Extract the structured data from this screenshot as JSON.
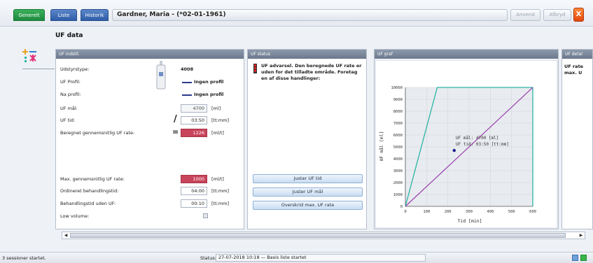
{
  "tabs": {
    "generelt": "Generelt",
    "liste": "Liste",
    "historik": "Historik"
  },
  "patient_title": "Gardner, Maria - (*02-01-1961)",
  "top_buttons": {
    "anvend": "Anvend",
    "afbryd": "Afbryd",
    "close": "X"
  },
  "section_title": "UF data",
  "panel_uf_settings": {
    "header": "UF indstil.",
    "dialyzer_label": "Udstyrstype:",
    "dialyzer_value": "4008",
    "uf_profile_label": "UF Profil:",
    "uf_profile_value": "Ingen profil",
    "na_profile_label": "Na profil:",
    "na_profile_value": "Ingen profil",
    "uf_goal_label": "UF mål:",
    "uf_goal_value": "4700",
    "uf_goal_unit": "[ml]",
    "uf_time_label": "UF tid:",
    "uf_time_value": "03:50",
    "uf_time_unit": "[tt:mm]",
    "avg_rate_label": "Beregnet gennemsnitlig UF rate:",
    "avg_rate_value": "1226",
    "avg_rate_unit": "[ml/t]",
    "max_rate_label": "Max. gennemsnitlig UF rate:",
    "max_rate_value": "1000",
    "max_rate_unit": "[ml/t]",
    "ordered_time_label": "Ordineret behandlingstid:",
    "ordered_time_value": "04:00",
    "ordered_time_unit": "[tt:mm]",
    "time_without_uf_label": "Behandlingstid uden UF:",
    "time_without_uf_value": "00:10",
    "time_without_uf_unit": "[tt:mm]",
    "low_volume_label": "Low volume:"
  },
  "panel_uf_status": {
    "header": "UF status",
    "warning": "UF advarsel. Den beregnede UF rate er uden for det tilladte område. Foretag en af disse handlinger:",
    "btn_adjust_time": "Juster UF tid",
    "btn_adjust_goal": "Juster UF mål",
    "btn_override": "Overskrid max. UF rate"
  },
  "panel_uf_graph": {
    "header": "UF graf",
    "annotation_line1": "UF mål: 4700 [ml]",
    "annotation_line2": "UF tid: 03:50 [tt:mm]"
  },
  "panel_uf_details": {
    "header": "UF detal",
    "text_line1": "UF rate",
    "text_line2": "max. U"
  },
  "chart_data": {
    "type": "line",
    "xlabel": "Tid [min]",
    "ylabel": "UF mål [ml]",
    "xlim": [
      0,
      600
    ],
    "ylim": [
      0,
      10000
    ],
    "xticks": [
      0,
      100,
      200,
      300,
      400,
      500,
      600
    ],
    "yticks": [
      0,
      1000,
      2000,
      3000,
      4000,
      5000,
      6000,
      7000,
      8000,
      9000,
      10000
    ],
    "grid": true,
    "colors": {
      "envelope": "#2bb5a5",
      "line": "#9b3fb0",
      "point": "#1a1a8c"
    },
    "series": [
      {
        "x": [
          0,
          150,
          600,
          600
        ],
        "y": [
          0,
          10000,
          10000,
          0
        ]
      },
      {
        "x": [
          0,
          600
        ],
        "y": [
          0,
          10000
        ]
      },
      {
        "x": [
          230
        ],
        "y": [
          4700
        ]
      }
    ]
  },
  "statusbar": {
    "left": "3 sessioner startet.",
    "label": "Status:",
    "value": "27-07-2018 10:18 — Basis liste startet"
  }
}
